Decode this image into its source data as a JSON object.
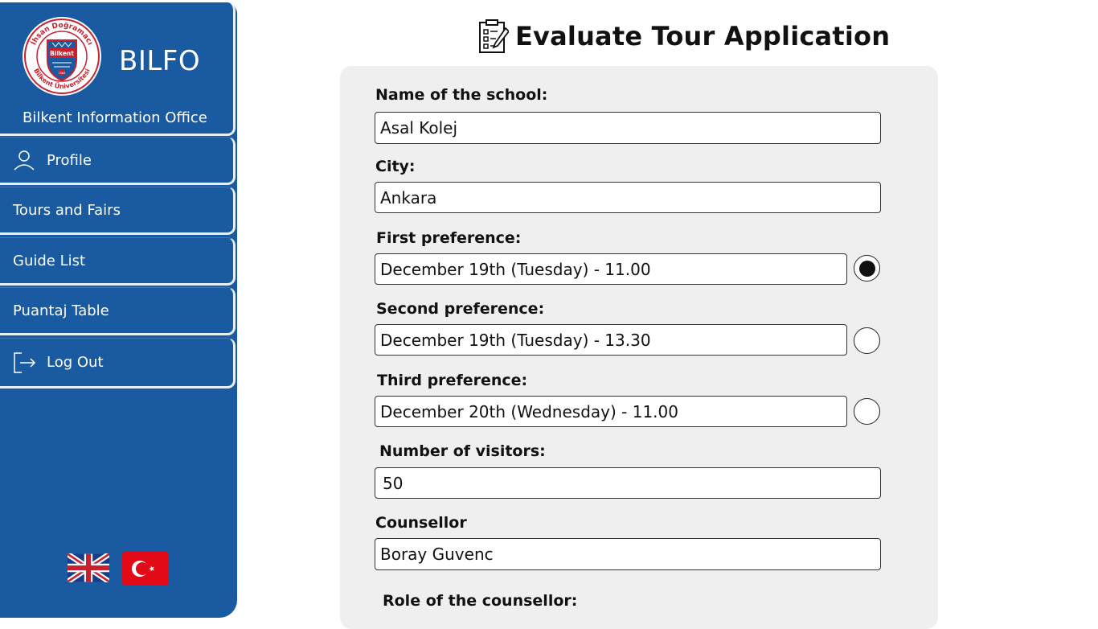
{
  "sidebar": {
    "brand_name": "BILFO",
    "brand_subtitle": "Bilkent Information Office",
    "logo_text_top": "İhsan Doğramacı",
    "logo_text_bottom": "Bilkent Üniversitesi",
    "logo_center": "Bilkent",
    "logo_year": "1984",
    "items": [
      {
        "label": "Profile",
        "icon": "user-icon"
      },
      {
        "label": "Tours and Fairs"
      },
      {
        "label": "Guide List"
      },
      {
        "label": "Puantaj Table"
      },
      {
        "label": "Log Out",
        "icon": "logout-icon"
      }
    ],
    "languages": [
      "english-flag",
      "turkish-flag"
    ]
  },
  "page": {
    "title": "Evaluate Tour Application",
    "title_icon": "checklist-icon"
  },
  "form": {
    "school_label": "Name of the school:",
    "school_value": "Asal Kolej",
    "city_label": "City:",
    "city_value": "Ankara",
    "first_label": "First preference:",
    "first_value": "December 19th (Tuesday) - 11.00",
    "first_selected": true,
    "second_label": "Second preference:",
    "second_value": "December 19th (Tuesday) - 13.30",
    "second_selected": false,
    "third_label": "Third preference:",
    "third_value": "December 20th (Wednesday) - 11.00",
    "third_selected": false,
    "visitors_label": "Number of visitors:",
    "visitors_value": "50",
    "counsellor_label": "Counsellor",
    "counsellor_value": "Boray Guvenc",
    "role_label": "Role of the counsellor:"
  },
  "colors": {
    "sidebar": "#1a5aa0",
    "card": "#efefef"
  }
}
